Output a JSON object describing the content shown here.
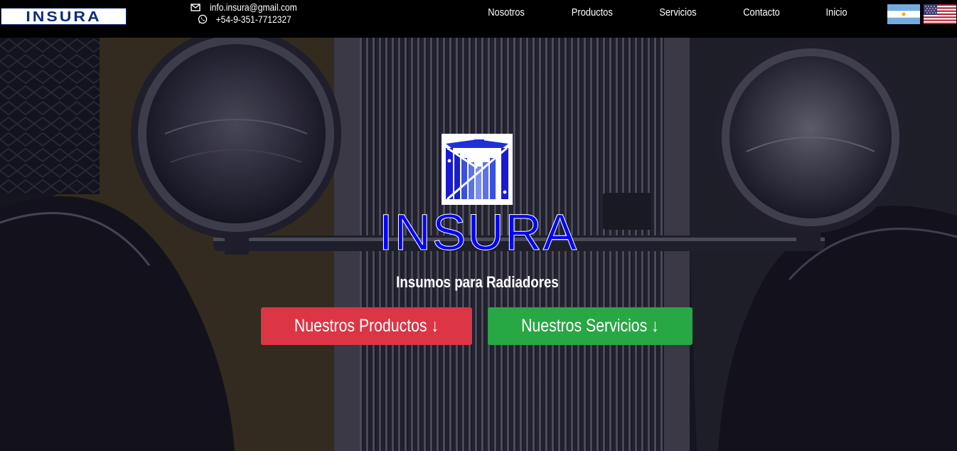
{
  "brand": {
    "logo_text": "INSURA"
  },
  "contact": {
    "email": "info.insura@gmail.com",
    "email_icon": "envelope-icon",
    "phone": "+54-9-351-7712327",
    "phone_icon": "whatsapp-icon"
  },
  "nav": {
    "items": [
      {
        "label": "Nosotros"
      },
      {
        "label": "Productos"
      },
      {
        "label": "Servicios"
      },
      {
        "label": "Contacto"
      },
      {
        "label": "Inicio"
      }
    ]
  },
  "languages": [
    {
      "name": "argentina-flag-icon"
    },
    {
      "name": "usa-flag-icon"
    }
  ],
  "hero": {
    "title": "INSURA",
    "subtitle": "Insumos para Radiadores",
    "buttons": {
      "products_label": "Nuestros Productos ↓",
      "services_label": "Nuestros Servicios ↓"
    }
  },
  "colors": {
    "navbar_bg": "#000000",
    "title_blue": "#0000ff",
    "products_btn": "#dc3545",
    "services_btn": "#28a745"
  }
}
